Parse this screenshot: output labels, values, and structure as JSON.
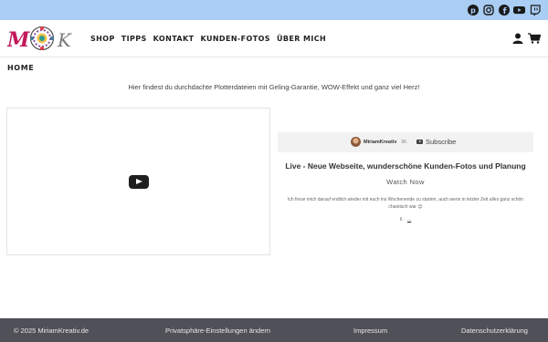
{
  "social": [
    "pinterest-icon",
    "instagram-icon",
    "facebook-icon",
    "youtube-icon",
    "twitch-icon"
  ],
  "nav": {
    "shop": "SHOP",
    "tipps": "TIPPS",
    "kontakt": "KONTAKT",
    "kunden_fotos": "KUNDEN-FOTOS",
    "ueber_mich": "ÜBER MICH"
  },
  "page": {
    "title": "HOME",
    "tagline": "Hier findest du durchdachte Plotterdateien mit Geling-Garantie, WOW-Effekt und ganz viel Herz!"
  },
  "video": {
    "channel_name": "MiriamKreativ",
    "channel_count": "9K",
    "subscribe_label": "Subscribe",
    "title": "Live - Neue Webseite, wunderschöne Kunden-Fotos und Planung",
    "watch_label": "Watch Now",
    "description": "Ich freue mich darauf endlich wieder mit euch ins Wochenende zu starten, auch wenn in letzter Zeit alles ganz schön chaotisch war 😊",
    "more_prefix": "ll ·",
    "more_link": "..."
  },
  "footer": {
    "copyright": "© 2025 MiriamKreativ.de",
    "privacy_settings": "Privatsphäre-Einstellungen ändern",
    "impressum": "Impressum",
    "datenschutz": "Datenschutzerklärung"
  },
  "colors": {
    "topbar": "#a9cdf3",
    "footer": "#505058",
    "logo_m": "#c2185b",
    "logo_k": "#7a7a7a"
  }
}
